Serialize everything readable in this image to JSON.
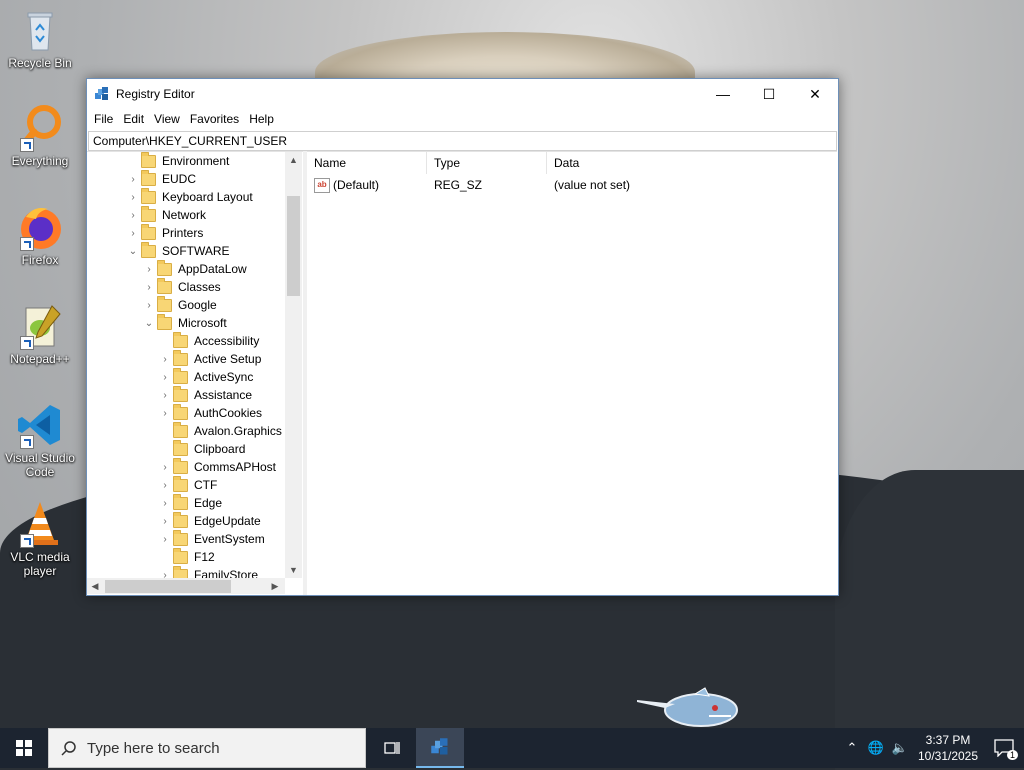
{
  "desktop": {
    "icons": [
      {
        "label": "Recycle Bin",
        "icon": "recycle-bin-icon"
      },
      {
        "label": "Everything",
        "icon": "everything-search-icon"
      },
      {
        "label": "Firefox",
        "icon": "firefox-icon"
      },
      {
        "label": "Notepad++",
        "icon": "notepad-plus-plus-icon"
      },
      {
        "label": "Visual Studio Code",
        "icon": "vscode-icon"
      },
      {
        "label": "VLC media player",
        "icon": "vlc-icon"
      }
    ]
  },
  "window": {
    "title": "Registry Editor",
    "controls": {
      "minimize": "—",
      "maximize": "☐",
      "close": "✕"
    },
    "menu": [
      "File",
      "Edit",
      "View",
      "Favorites",
      "Help"
    ],
    "address": "Computer\\HKEY_CURRENT_USER",
    "tree": [
      {
        "label": "Environment",
        "expander": ""
      },
      {
        "label": "EUDC",
        "expander": "›"
      },
      {
        "label": "Keyboard Layout",
        "expander": "›"
      },
      {
        "label": "Network",
        "expander": "›"
      },
      {
        "label": "Printers",
        "expander": "›"
      },
      {
        "label": "SOFTWARE",
        "expander": "⌄"
      },
      {
        "label": "AppDataLow",
        "expander": "›"
      },
      {
        "label": "Classes",
        "expander": "›"
      },
      {
        "label": "Google",
        "expander": "›"
      },
      {
        "label": "Microsoft",
        "expander": "⌄"
      },
      {
        "label": "Accessibility",
        "expander": ""
      },
      {
        "label": "Active Setup",
        "expander": "›"
      },
      {
        "label": "ActiveSync",
        "expander": "›"
      },
      {
        "label": "Assistance",
        "expander": "›"
      },
      {
        "label": "AuthCookies",
        "expander": "›"
      },
      {
        "label": "Avalon.Graphics",
        "expander": ""
      },
      {
        "label": "Clipboard",
        "expander": ""
      },
      {
        "label": "CommsAPHost",
        "expander": "›"
      },
      {
        "label": "CTF",
        "expander": "›"
      },
      {
        "label": "Edge",
        "expander": "›"
      },
      {
        "label": "EdgeUpdate",
        "expander": "›"
      },
      {
        "label": "EventSystem",
        "expander": "›"
      },
      {
        "label": "F12",
        "expander": ""
      },
      {
        "label": "FamilyStore",
        "expander": "›"
      }
    ],
    "list": {
      "headers": {
        "name": "Name",
        "type": "Type",
        "data": "Data"
      },
      "rows": [
        {
          "icon": "ab",
          "name": "(Default)",
          "type": "REG_SZ",
          "data": "(value not set)"
        }
      ]
    }
  },
  "taskbar": {
    "search_placeholder": "Type here to search",
    "clock_time": "3:37 PM",
    "clock_date": "10/31/2025",
    "notification_count": "1"
  }
}
